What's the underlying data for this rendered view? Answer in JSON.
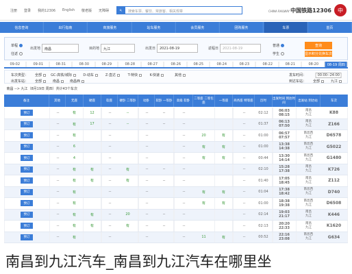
{
  "header": {
    "logo_mark": "中",
    "logo_name": "中国铁路12306",
    "logo_en": "CHINA RAILWAY",
    "search_placeholder": "搜索车票、餐饮、常旅客、相关规章",
    "links": [
      "无障碍",
      "敬老版",
      "English",
      "我的12306",
      "登录",
      "注册"
    ]
  },
  "nav": [
    "首页",
    "车票",
    "团购服务",
    "会员服务",
    "站车服务",
    "商旅服务",
    "出行指南",
    "信息查询"
  ],
  "nav_active": 1,
  "query": {
    "radio_single": "单程",
    "radio_round": "往返",
    "from_label": "出发地",
    "from_value": "南昌",
    "to_label": "目的地",
    "to_value": "九江",
    "depart_label": "出发日",
    "depart_value": "2021-08-19",
    "return_label": "返程日",
    "return_value": "2021-08-19",
    "radio_normal": "普通",
    "radio_student": "学生",
    "query_button": "查询",
    "query_button2": "显示积分兑换车次"
  },
  "dates": [
    "08-19 周四",
    "08-20",
    "08-21",
    "08-22",
    "08-23",
    "08-24",
    "08-25",
    "08-26",
    "08-27",
    "08-28",
    "08-29",
    "08-30",
    "08-31",
    "09-01",
    "09-02"
  ],
  "dates_active": 0,
  "filter": {
    "type_label": "车次类型：",
    "types": [
      "全部",
      "GC-高铁/城际",
      "D-动车",
      "Z-直达",
      "T-特快",
      "K-快速",
      "其他"
    ],
    "station_label": "出发车站：",
    "stations": [
      "全部",
      "南昌",
      "南昌西"
    ],
    "time_label": "发车时间：",
    "time_value": "00:00--24:00",
    "arrive_label": "到达车站：",
    "arrive_stations": [
      "全部",
      "九江"
    ]
  },
  "info_text": "南昌 --> 九江（8月19日 周四）共计43个车次",
  "table": {
    "headers": [
      "车次",
      "出发站 到达站",
      "出发时间 到达时间",
      "历时",
      "商务座 特等座",
      "一等座",
      "二等座 二等包座",
      "高级 软卧",
      "软卧 一等卧",
      "动卧",
      "硬卧 二等卧",
      "软座",
      "硬座",
      "无座",
      "其他",
      "备注"
    ],
    "book_label": "预订",
    "rows": [
      {
        "train": "K88",
        "from": "南昌",
        "to": "九江",
        "dep": "06:03",
        "arr": "08:15",
        "dur": "02:12",
        "ruan": "--",
        "ying_wo": "--",
        "ying_zuo": "12",
        "wu": "有"
      },
      {
        "train": "Z166",
        "from": "南昌",
        "to": "九江",
        "dep": "06:13",
        "arr": "07:50",
        "dur": "01:37",
        "ruan": "--",
        "ying_wo": "--",
        "ying_zuo": "17",
        "wu": "有"
      },
      {
        "train": "D6578",
        "from": "南昌西",
        "to": "九江",
        "dep": "06:57",
        "arr": "07:57",
        "dur": "01:00",
        "yd": "有",
        "ed": "20",
        "ruan": "",
        "ying_wo": "",
        "ying_zuo": "",
        "wu": "有"
      },
      {
        "train": "G5022",
        "from": "南昌西",
        "to": "九江",
        "dep": "13:38",
        "arr": "14:38",
        "dur": "01:00",
        "yd": "有",
        "ed": "有",
        "ruan": "",
        "ying_wo": "",
        "ying_zuo": "",
        "wu": "6"
      },
      {
        "train": "G1480",
        "from": "南昌西",
        "to": "九江",
        "dep": "13:30",
        "arr": "14:14",
        "dur": "00:44",
        "yd": "有",
        "ed": "有",
        "ruan": "",
        "ying_wo": "",
        "ying_zuo": "",
        "wu": "4"
      },
      {
        "train": "K726",
        "from": "南昌",
        "to": "九江",
        "dep": "15:28",
        "arr": "17:38",
        "dur": "02:10",
        "ruan": "--",
        "ying_wo": "有",
        "ying_zuo": "有",
        "wu": "有"
      },
      {
        "train": "Z112",
        "from": "南昌",
        "to": "九江",
        "dep": "17:05",
        "arr": "18:45",
        "dur": "01:40",
        "ruan": "--",
        "ying_wo": "有",
        "ying_zuo": "有",
        "wu": "有"
      },
      {
        "train": "D740",
        "from": "南昌西",
        "to": "九江",
        "dep": "17:38",
        "arr": "18:42",
        "dur": "01:04",
        "yd": "有",
        "ed": "有",
        "ruan": "",
        "ying_wo": "",
        "ying_zuo": "",
        "wu": "有"
      },
      {
        "train": "D6508",
        "from": "南昌西",
        "to": "九江",
        "dep": "18:38",
        "arr": "19:38",
        "dur": "01:00",
        "yd": "有",
        "ed": "有",
        "ruan": "",
        "ying_wo": "",
        "ying_zuo": "",
        "wu": "有"
      },
      {
        "train": "K446",
        "from": "南昌",
        "to": "九江",
        "dep": "19:03",
        "arr": "21:17",
        "dur": "02:14",
        "ruan": "--",
        "ying_wo": "20",
        "ying_zuo": "有",
        "wu": "有"
      },
      {
        "train": "K1620",
        "from": "南昌",
        "to": "九江",
        "dep": "20:20",
        "arr": "22:33",
        "dur": "02:13",
        "ruan": "--",
        "ying_wo": "有",
        "ying_zuo": "有",
        "wu": "有"
      },
      {
        "train": "G634",
        "from": "南昌西",
        "to": "九江",
        "dep": "22:16",
        "arr": "23:08",
        "dur": "00:52",
        "yd": "有",
        "ed": "11",
        "ruan": "",
        "ying_wo": "",
        "ying_zuo": "",
        "wu": "有"
      }
    ]
  },
  "caption": "南昌到九江汽车_南昌到九江汽车在哪里坐"
}
